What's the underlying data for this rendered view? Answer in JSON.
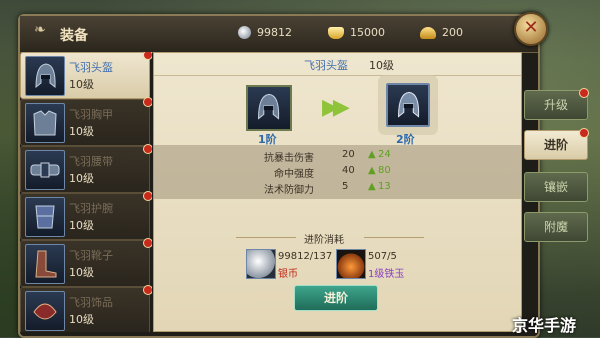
{
  "title": "装备",
  "currencies": [
    {
      "icon": "silver-coin-icon",
      "value": "99812"
    },
    {
      "icon": "gold-ingot-icon",
      "value": "15000"
    },
    {
      "icon": "yuanbao-icon",
      "value": "200"
    }
  ],
  "equipment_list": [
    {
      "name": "飞羽头盔",
      "level": "10级",
      "active": true
    },
    {
      "name": "飞羽胸甲",
      "level": "10级",
      "active": false
    },
    {
      "name": "飞羽腰带",
      "level": "10级",
      "active": false
    },
    {
      "name": "飞羽护腕",
      "level": "10级",
      "active": false
    },
    {
      "name": "飞羽靴子",
      "level": "10级",
      "active": false
    },
    {
      "name": "飞羽饰品",
      "level": "10级",
      "active": false
    }
  ],
  "selected": {
    "name": "飞羽头盔",
    "level": "10级",
    "current_stage": "1阶",
    "next_stage": "2阶"
  },
  "stats": [
    {
      "label": "抗暴击伤害",
      "current": "20",
      "next": "24"
    },
    {
      "label": "命中强度",
      "current": "40",
      "next": "80"
    },
    {
      "label": "法术防御力",
      "current": "5",
      "next": "13"
    }
  ],
  "cost": {
    "title": "进阶消耗",
    "items": [
      {
        "amount": "99812/137",
        "name": "银币",
        "icon": "silver-coin-icon"
      },
      {
        "amount": "507/5",
        "name": "1级铁玉",
        "icon": "iron-jade-icon"
      }
    ]
  },
  "advance_button": "进阶",
  "tabs": [
    {
      "label": "升级",
      "active": false
    },
    {
      "label": "进阶",
      "active": true
    },
    {
      "label": "镶嵌",
      "active": false
    },
    {
      "label": "附魔",
      "active": false
    }
  ],
  "watermark": "京华手游"
}
